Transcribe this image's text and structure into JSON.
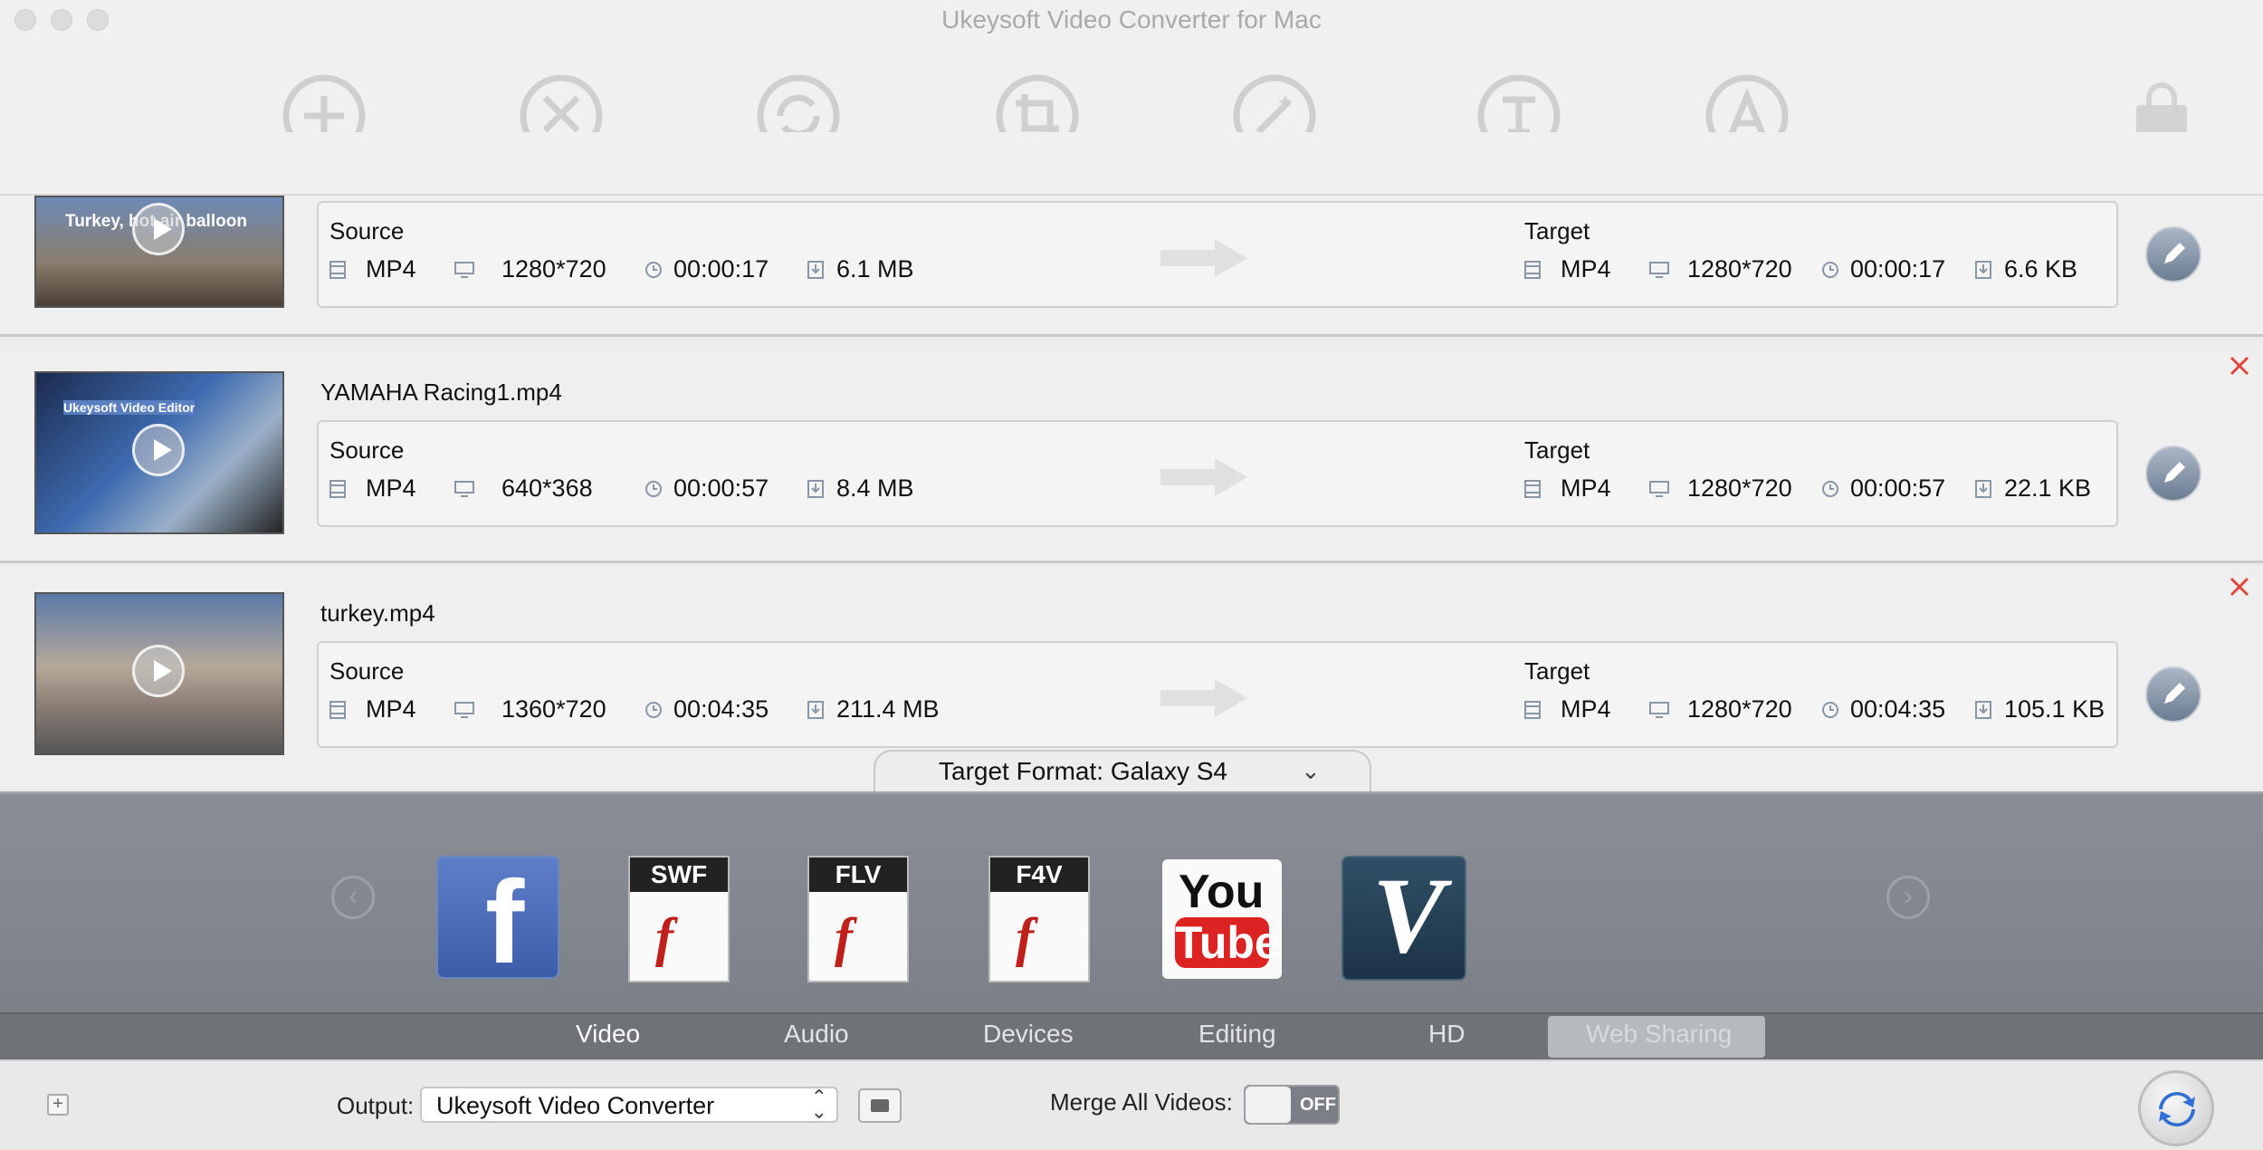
{
  "window": {
    "title": "Ukeysoft Video Converter for Mac"
  },
  "toolbar": {
    "tools": [
      {
        "icon": "add-icon"
      },
      {
        "icon": "scissors-icon"
      },
      {
        "icon": "rotate-icon"
      },
      {
        "icon": "crop-icon"
      },
      {
        "icon": "effects-wand-icon"
      },
      {
        "icon": "subtitle-icon"
      },
      {
        "icon": "watermark-icon"
      },
      {
        "icon": "shop-bag-icon"
      }
    ]
  },
  "files": [
    {
      "name": "",
      "thumb_caption": "Turkey, hot air balloon",
      "source": {
        "label": "Source",
        "format": "MP4",
        "resolution": "1280*720",
        "duration": "00:00:17",
        "size": "6.1 MB"
      },
      "target": {
        "label": "Target",
        "format": "MP4",
        "resolution": "1280*720",
        "duration": "00:00:17",
        "size": "6.6 KB"
      }
    },
    {
      "name": "YAMAHA Racing1.mp4",
      "thumb_caption": "Ukeysoft Video Editor",
      "source": {
        "label": "Source",
        "format": "MP4",
        "resolution": "640*368",
        "duration": "00:00:57",
        "size": "8.4 MB"
      },
      "target": {
        "label": "Target",
        "format": "MP4",
        "resolution": "1280*720",
        "duration": "00:00:57",
        "size": "22.1 KB"
      }
    },
    {
      "name": "turkey.mp4",
      "thumb_caption": "",
      "source": {
        "label": "Source",
        "format": "MP4",
        "resolution": "1360*720",
        "duration": "00:04:35",
        "size": "211.4 MB"
      },
      "target": {
        "label": "Target",
        "format": "MP4",
        "resolution": "1280*720",
        "duration": "00:04:35",
        "size": "105.1 KB"
      }
    }
  ],
  "target_format": {
    "label": "Target Format: Galaxy S4"
  },
  "formats": {
    "swf": "SWF",
    "flv": "FLV",
    "f4v": "F4V",
    "youtube_top": "You",
    "youtube_bottom": "Tube"
  },
  "categories": [
    {
      "label": "Video"
    },
    {
      "label": "Audio"
    },
    {
      "label": "Devices"
    },
    {
      "label": "Editing"
    },
    {
      "label": "HD"
    },
    {
      "label": "Web Sharing"
    }
  ],
  "bottom": {
    "output_label": "Output:",
    "output_value": "Ukeysoft Video Converter",
    "merge_label": "Merge All Videos:",
    "merge_state": "OFF"
  },
  "colors": {
    "accent": "#e0463a",
    "format_bg": "#858990",
    "tab_bar": "#6f7378"
  }
}
